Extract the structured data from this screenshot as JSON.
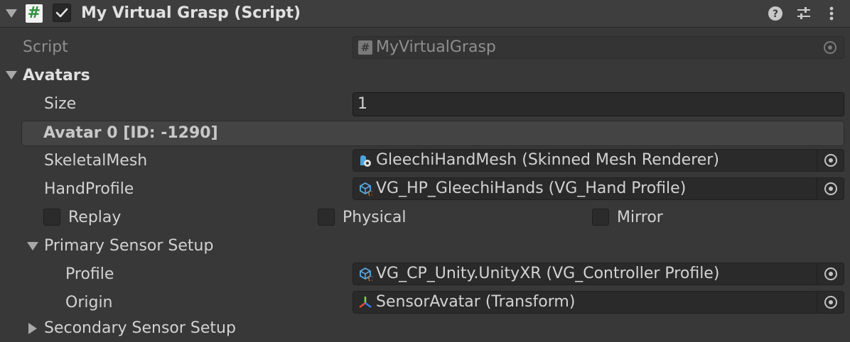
{
  "component": {
    "title": "My Virtual Grasp (Script)",
    "script_icon_glyph": "#",
    "enabled": true,
    "icons": [
      "help-icon",
      "preset-icon",
      "kebab-menu-icon"
    ]
  },
  "script_row": {
    "label": "Script",
    "value": "MyVirtualGrasp",
    "value_icon": "#"
  },
  "avatars": {
    "label": "Avatars",
    "size_label": "Size",
    "size_value": "1",
    "element_header": "Avatar 0 [ID: -1290]",
    "skeletal_mesh": {
      "label": "SkeletalMesh",
      "value": "GleechiHandMesh (Skinned Mesh Renderer)"
    },
    "hand_profile": {
      "label": "HandProfile",
      "value": "VG_HP_GleechiHands (VG_Hand Profile)"
    },
    "toggles": [
      {
        "label": "Replay",
        "checked": false
      },
      {
        "label": "Physical",
        "checked": false
      },
      {
        "label": "Mirror",
        "checked": false
      }
    ],
    "primary_sensor": {
      "label": "Primary Sensor Setup",
      "profile": {
        "label": "Profile",
        "value": "VG_CP_Unity.UnityXR (VG_Controller Profile)"
      },
      "origin": {
        "label": "Origin",
        "value": "SensorAvatar (Transform)"
      }
    },
    "secondary_sensor": {
      "label": "Secondary Sensor Setup"
    }
  },
  "colors": {
    "background": "#383838",
    "header": "#3e3e3e",
    "field": "#2a2a2a",
    "text": "#d2d2d2",
    "muted_text": "#8f8f8f",
    "script_icon_green": "#3a9a4c"
  }
}
